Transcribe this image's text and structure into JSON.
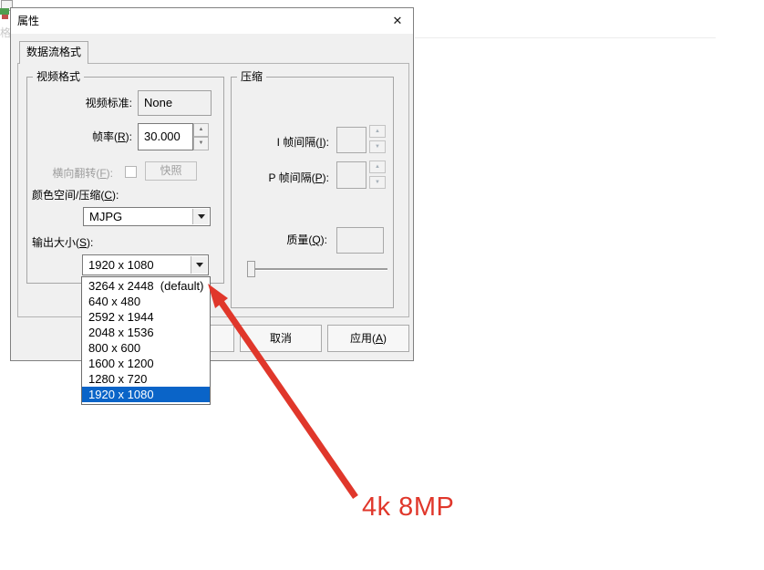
{
  "window": {
    "title": "属性"
  },
  "icons": {
    "close": "✕",
    "spin_up": "▲",
    "spin_down": "▼"
  },
  "tab": {
    "label": "数据流格式"
  },
  "video_format_group": {
    "title": "视频格式",
    "video_standard_label": "视频标准:",
    "video_standard_value": "None",
    "frame_rate_label": {
      "pre": "帧率(",
      "key": "R",
      "post": "):"
    },
    "frame_rate_value": "30.000",
    "flip_label": {
      "pre": "横向翻转(",
      "key": "F",
      "post": "):"
    },
    "snapshot_button": "快照",
    "color_space_label": {
      "pre": "颜色空间/压缩(",
      "key": "C",
      "post": "):"
    },
    "color_space_value": "MJPG",
    "output_size_label": {
      "pre": "输出大小(",
      "key": "S",
      "post": "):"
    },
    "output_size_value": "1920 x 1080"
  },
  "output_size_dropdown": {
    "items": [
      "3264 x 2448  (default)",
      "640 x 480",
      "2592 x 1944",
      "2048 x 1536",
      "800 x 600",
      "1600 x 1200",
      "1280 x 720",
      "1920 x 1080"
    ],
    "selected_index": 7
  },
  "compression_group": {
    "title": "压缩",
    "i_frame_label": {
      "pre": "I 帧间隔(",
      "key": "I",
      "post": "):"
    },
    "p_frame_label": {
      "pre": "P 帧间隔(",
      "key": "P",
      "post": "):"
    },
    "quality_label": {
      "pre": "质量(",
      "key": "Q",
      "post": "):"
    }
  },
  "buttons": {
    "ok": "",
    "cancel": "取消",
    "apply": {
      "pre": "应用(",
      "key": "A",
      "post": ")"
    }
  },
  "annotation": {
    "text": "4k 8MP"
  },
  "colors": {
    "highlight": "#0a64c8",
    "annotation": "#e0372b"
  }
}
